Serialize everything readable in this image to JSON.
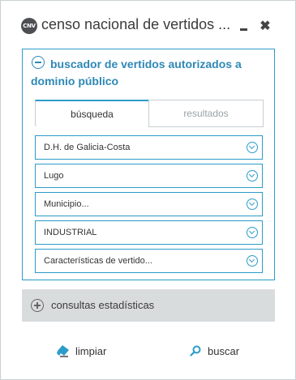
{
  "header": {
    "logo_text": "CNV",
    "title": "censo nacional de vertidos ...",
    "minimize_icon": "minimize-icon",
    "close_label": "✖"
  },
  "search_panel": {
    "title": "buscador de vertidos autorizados a dominio público",
    "tabs": [
      {
        "label": "búsqueda",
        "active": true
      },
      {
        "label": "resultados",
        "active": false
      }
    ],
    "selects": [
      {
        "label": "D.H. de Galicia-Costa"
      },
      {
        "label": "Lugo"
      },
      {
        "label": "Municipio..."
      },
      {
        "label": "INDUSTRIAL"
      },
      {
        "label": "Características de vertido..."
      }
    ]
  },
  "stats_panel": {
    "title": "consultas estadísticas"
  },
  "actions": {
    "clear_label": "limpiar",
    "search_label": "buscar"
  },
  "colors": {
    "accent": "#2b9cc9",
    "title_blue": "#2e88b5",
    "collapsed_bg": "#d9dcdd"
  }
}
